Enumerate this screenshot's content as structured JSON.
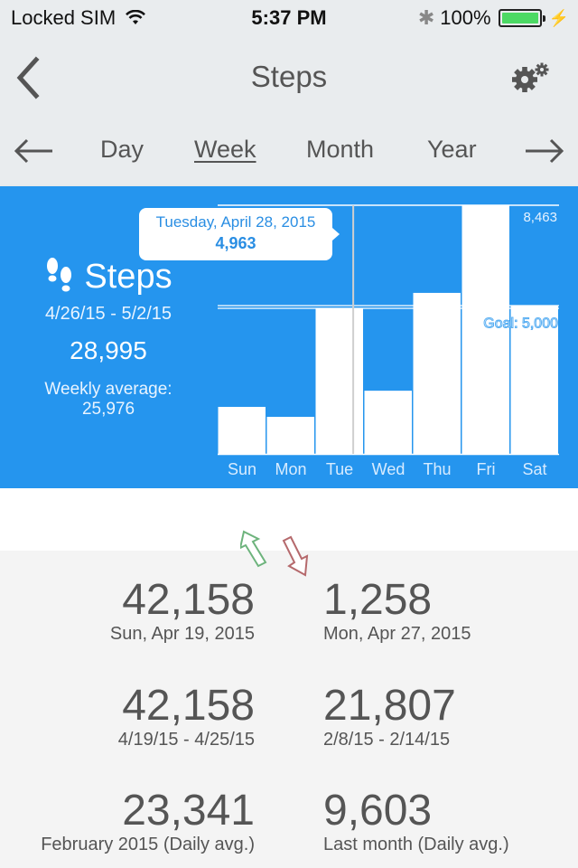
{
  "status_bar": {
    "carrier": "Locked SIM",
    "time": "5:37 PM",
    "battery": "100%",
    "battery_level": 1.0
  },
  "nav": {
    "title": "Steps",
    "back_icon": "chevron-left-icon",
    "settings_icon": "gears-icon"
  },
  "periods": {
    "prev_icon": "arrow-left-icon",
    "next_icon": "arrow-right-icon",
    "tabs": [
      {
        "label": "Day",
        "active": false
      },
      {
        "label": "Week",
        "active": true
      },
      {
        "label": "Month",
        "active": false
      },
      {
        "label": "Year",
        "active": false
      }
    ]
  },
  "summary": {
    "title": "Steps",
    "icon": "footprints-icon",
    "range": "4/26/15 - 5/2/15",
    "total": "28,995",
    "avg_label": "Weekly average:",
    "avg_value": "25,976"
  },
  "tooltip": {
    "date": "Tuesday, April 28, 2015",
    "value": "4,963"
  },
  "chart_data": {
    "type": "bar",
    "title": "Steps",
    "categories": [
      "Sun",
      "Mon",
      "Tue",
      "Wed",
      "Thu",
      "Fri",
      "Sat"
    ],
    "values": [
      1600,
      1260,
      4963,
      2150,
      5480,
      8463,
      5050
    ],
    "selected_index": 2,
    "max_label": "8,463",
    "max_value": 8463,
    "goal_label": "Goal: 5,000",
    "goal_value": 5000,
    "ylim": [
      0,
      8463
    ],
    "xlabel": "",
    "ylabel": "",
    "grid": false,
    "colors": {
      "background": "#2595ee",
      "bar": "#ffffff",
      "selected_line": "#cfcfcf"
    }
  },
  "trend": {
    "up_color": "#6db37c",
    "down_color": "#b5696c"
  },
  "stats": [
    {
      "value": "42,158",
      "label": "Sun, Apr 19, 2015"
    },
    {
      "value": "1,258",
      "label": "Mon, Apr 27, 2015"
    },
    {
      "value": "42,158",
      "label": "4/19/15 - 4/25/15"
    },
    {
      "value": "21,807",
      "label": "2/8/15 - 2/14/15"
    },
    {
      "value": "23,341",
      "label": "February 2015 (Daily avg.)"
    },
    {
      "value": "9,603",
      "label": "Last month (Daily avg.)"
    }
  ]
}
